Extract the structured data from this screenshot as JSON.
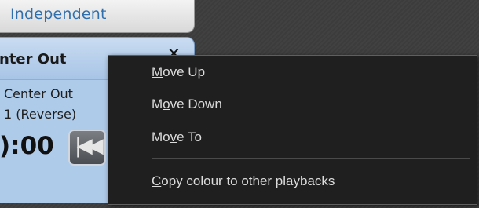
{
  "tab": {
    "label": "Independent"
  },
  "playback": {
    "title": "nter Out",
    "close_glyph": "✕",
    "line1": "Center Out",
    "line2": "1 (Reverse)",
    "time": "):00",
    "rewind_icon": "skip-back-icon"
  },
  "menu": {
    "items": [
      {
        "pre": "",
        "key": "M",
        "post": "ove Up"
      },
      {
        "pre": "M",
        "key": "o",
        "post": "ve Down"
      },
      {
        "pre": "Mo",
        "key": "v",
        "post": "e To"
      },
      {
        "pre": "",
        "key": "C",
        "post": "opy colour to other playbacks"
      }
    ]
  },
  "colors": {
    "menu_bg": "#1f1f1f",
    "menu_text": "#dcdcdc",
    "panel_bg": "#aecbea",
    "tab_text": "#2f6fae"
  }
}
